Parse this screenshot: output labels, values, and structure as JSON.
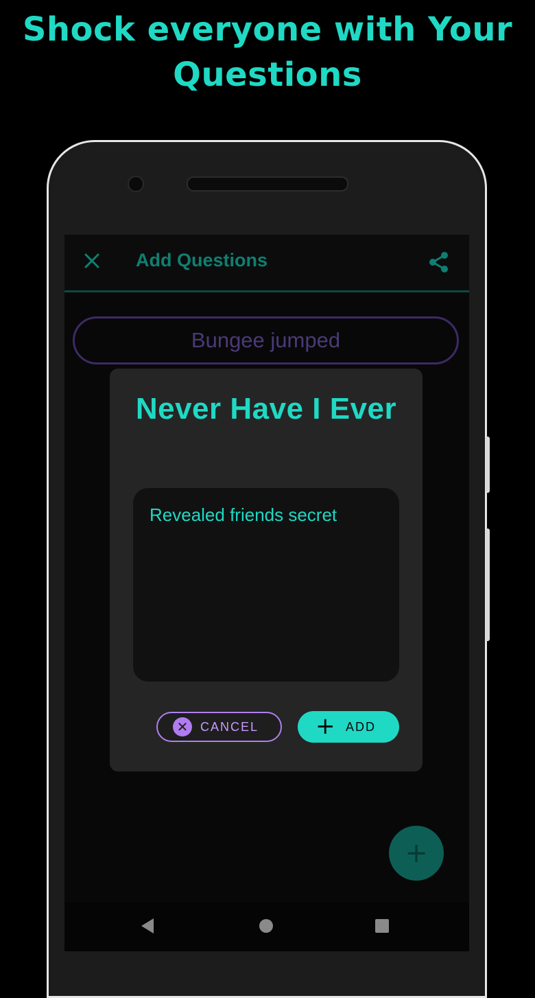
{
  "promo": {
    "title": "Shock everyone with Your Questions"
  },
  "appbar": {
    "title": "Add Questions",
    "close_icon": "close-icon",
    "share_icon": "share-icon"
  },
  "question_card": {
    "text": "Bungee jumped"
  },
  "dialog": {
    "title": "Never Have I Ever",
    "input_value": "Revealed friends secret",
    "cancel_label": "CANCEL",
    "add_label": "ADD"
  },
  "fab": {
    "icon": "plus-icon"
  },
  "navbar": {
    "back_icon": "back-icon",
    "home_icon": "home-icon",
    "recent_icon": "recent-apps-icon"
  },
  "colors": {
    "accent": "#1fd9c4",
    "purple": "#b080f0",
    "background": "#000000"
  }
}
